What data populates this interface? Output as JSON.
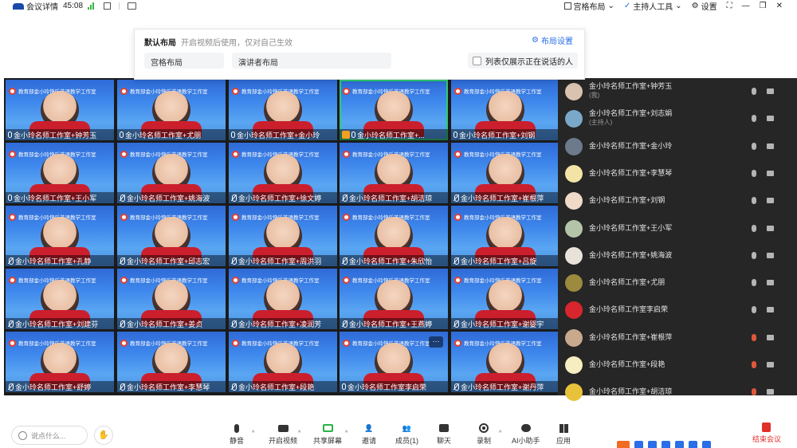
{
  "topbar": {
    "meeting_info": "会议详情",
    "timer": "45:08",
    "layout": "宫格布局",
    "host_tools": "主持人工具",
    "settings": "设置"
  },
  "layout_panel": {
    "title": "默认布局",
    "subtitle": "开启视频后使用，仅对自己生效",
    "settings_link": "布局设置",
    "options": [
      "宫格布局",
      "演讲者布局"
    ],
    "checkbox_label": "列表仅展示正在说话的人"
  },
  "banner_text": "教育部金小玲快乐英语教学工作室",
  "more_label": "···",
  "tiles": [
    {
      "name": "金小玲名师工作室+钟芳玉",
      "mic": "on"
    },
    {
      "name": "金小玲名师工作室+尤朋",
      "mic": "on"
    },
    {
      "name": "金小玲名师工作室+金小玲",
      "mic": "on"
    },
    {
      "name": "金小玲名师工作室+...",
      "mic": "on",
      "host": true,
      "active": true
    },
    {
      "name": "金小玲名师工作室+刘钢",
      "mic": "on"
    },
    {
      "name": "金小玲名师工作室+王小军",
      "mic": "on"
    },
    {
      "name": "金小玲名师工作室+姚海波",
      "mic": "off"
    },
    {
      "name": "金小玲名师工作室+徐文婷",
      "mic": "off"
    },
    {
      "name": "金小玲名师工作室+胡洁琼",
      "mic": "off"
    },
    {
      "name": "金小玲名师工作室+崔根萍",
      "mic": "off"
    },
    {
      "name": "金小玲名师工作室+孔静",
      "mic": "off"
    },
    {
      "name": "金小玲名师工作室+邱志宏",
      "mic": "off"
    },
    {
      "name": "金小玲名师工作室+周洪羽",
      "mic": "off"
    },
    {
      "name": "金小玲名师工作室+朱欣怡",
      "mic": "off"
    },
    {
      "name": "金小玲名师工作室+吕旋",
      "mic": "off"
    },
    {
      "name": "金小玲名师工作室+刘建芬",
      "mic": "off"
    },
    {
      "name": "金小玲名师工作室+姜贞",
      "mic": "off"
    },
    {
      "name": "金小玲名师工作室+凌润芳",
      "mic": "off"
    },
    {
      "name": "金小玲名师工作室+王燕婷",
      "mic": "off"
    },
    {
      "name": "金小玲名师工作室+谢婴宇",
      "mic": "off"
    },
    {
      "name": "金小玲名师工作室+舒婷",
      "mic": "off"
    },
    {
      "name": "金小玲名师工作室+李慧琴",
      "mic": "off"
    },
    {
      "name": "金小玲名师工作室+段艳",
      "mic": "off"
    },
    {
      "name": "金小玲名师工作室李启荣",
      "mic": "on",
      "more": true
    },
    {
      "name": "金小玲名师工作室+谢丹萍",
      "mic": "off"
    }
  ],
  "members": [
    {
      "name": "金小玲名师工作室+钟芳玉",
      "sub": "(我)",
      "avatar_color": "#d9c3b0",
      "mic": "on"
    },
    {
      "name": "金小玲名师工作室+刘志娟",
      "sub": "(主持人)",
      "avatar_color": "#7aa8c9",
      "mic": "on"
    },
    {
      "name": "金小玲名师工作室+金小玲",
      "sub": "",
      "avatar_color": "#6c7a8c",
      "mic": "on"
    },
    {
      "name": "金小玲名师工作室+李慧琴",
      "sub": "",
      "avatar_color": "#f3e3a5",
      "mic": "on"
    },
    {
      "name": "金小玲名师工作室+刘钢",
      "sub": "",
      "avatar_color": "#f1d9c8",
      "mic": "on"
    },
    {
      "name": "金小玲名师工作室+王小军",
      "sub": "",
      "avatar_color": "#b4c4a8",
      "mic": "on"
    },
    {
      "name": "金小玲名师工作室+姚海波",
      "sub": "",
      "avatar_color": "#e8e2d8",
      "mic": "on"
    },
    {
      "name": "金小玲名师工作室+尤朋",
      "sub": "",
      "avatar_color": "#9c8a3e",
      "mic": "on"
    },
    {
      "name": "金小玲名师工作室李启荣",
      "sub": "",
      "avatar_color": "#d7262d",
      "mic": "on"
    },
    {
      "name": "金小玲名师工作室+崔根萍",
      "sub": "",
      "avatar_color": "#c9a98e",
      "mic": "off"
    },
    {
      "name": "金小玲名师工作室+段艳",
      "sub": "",
      "avatar_color": "#f6eec0",
      "mic": "off"
    },
    {
      "name": "金小玲名师工作室+胡洁琼",
      "sub": "",
      "avatar_color": "#e8c23a",
      "mic": "off"
    }
  ],
  "bottombar": {
    "say_placeholder": "说点什么...",
    "tools": [
      "静音",
      "开启视频",
      "共享屏幕",
      "邀请",
      "成员(1)",
      "聊天",
      "录制",
      "AI小助手",
      "应用"
    ],
    "end_label": "结束会议"
  }
}
